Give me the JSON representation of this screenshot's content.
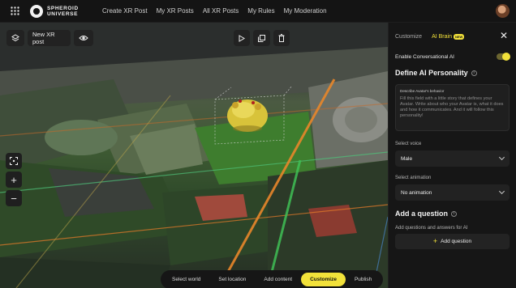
{
  "brand": {
    "line1": "SPHEROID",
    "line2": "UNIVERSE"
  },
  "nav": [
    "Create XR Post",
    "My XR Posts",
    "All XR Posts",
    "My Rules",
    "My Moderation"
  ],
  "toolbar": {
    "post_name": "New XR post"
  },
  "steps": [
    "Select world",
    "Set location",
    "Add content",
    "Customize",
    "Publish"
  ],
  "active_step": "Customize",
  "panel": {
    "tabs": [
      "Customize",
      "AI Brain"
    ],
    "new_badge": "NEW",
    "toggle_label": "Enable Conversational AI",
    "toggle_on": true,
    "personality_title": "Define AI Personality",
    "textarea_label": "Describe Avatar's behavior",
    "textarea_placeholder": "Fill this field with a little story that defines your Avatar. Write about who your Avatar is, what it does and how it communicates. And it will follow this personality!",
    "voice_label": "Select voice",
    "voice_value": "Male",
    "animation_label": "Select animation",
    "animation_value": "No animation",
    "question_title": "Add a question",
    "question_hint": "Add questions and answers for AI",
    "add_question": "Add question"
  },
  "colors": {
    "accent": "#f2e13a",
    "panel_bg": "#161616",
    "topbar_bg": "#141414"
  }
}
